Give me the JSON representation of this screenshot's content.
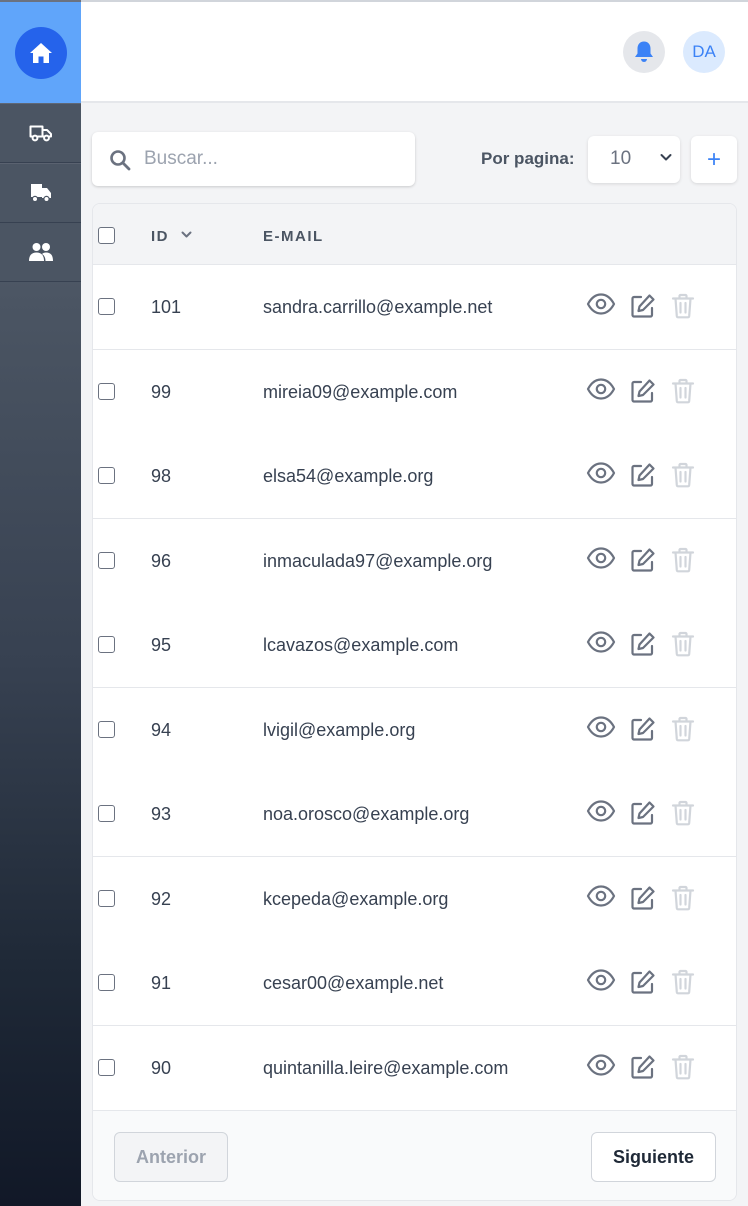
{
  "header": {
    "avatar_initials": "DA"
  },
  "sidebar": {
    "items": [
      {
        "icon": "home-icon"
      },
      {
        "icon": "truck-icon"
      },
      {
        "icon": "truck-loading-icon"
      },
      {
        "icon": "users-icon"
      }
    ]
  },
  "toolbar": {
    "search_placeholder": "Buscar...",
    "per_page_label": "Por pagina:",
    "per_page_value": "10",
    "add_label": "+"
  },
  "table": {
    "columns": [
      "ID",
      "E-MAIL"
    ],
    "rows": [
      {
        "id": "101",
        "email": "sandra.carrillo@example.net"
      },
      {
        "id": "99",
        "email": "mireia09@example.com"
      },
      {
        "id": "98",
        "email": "elsa54@example.org"
      },
      {
        "id": "96",
        "email": "inmaculada97@example.org"
      },
      {
        "id": "95",
        "email": "lcavazos@example.com"
      },
      {
        "id": "94",
        "email": "lvigil@example.org"
      },
      {
        "id": "93",
        "email": "noa.orosco@example.org"
      },
      {
        "id": "92",
        "email": "kcepeda@example.org"
      },
      {
        "id": "91",
        "email": "cesar00@example.net"
      },
      {
        "id": "90",
        "email": "quintanilla.leire@example.com"
      }
    ]
  },
  "pagination": {
    "prev_label": "Anterior",
    "next_label": "Siguiente"
  },
  "colors": {
    "accent": "#2563eb",
    "accent_light": "#60a5fa",
    "sidebar_dark": "#111827"
  }
}
